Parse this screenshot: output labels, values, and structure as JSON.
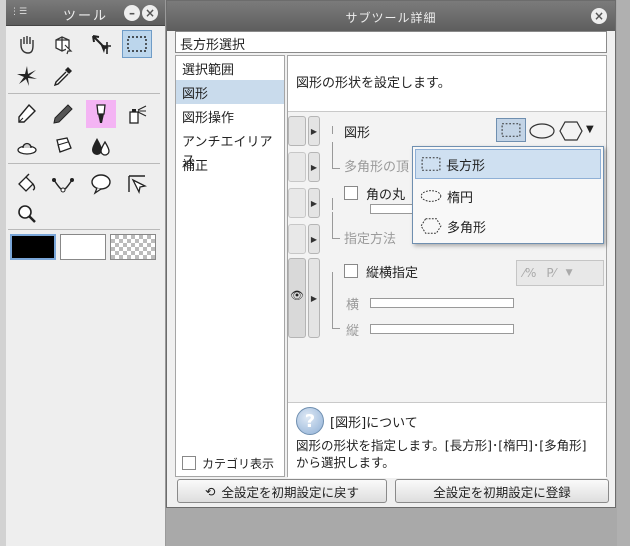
{
  "tool_panel": {
    "title": "ツール",
    "tools": [
      {
        "name": "hand-icon"
      },
      {
        "name": "object-icon"
      },
      {
        "name": "move-icon"
      },
      {
        "name": "selection-icon"
      },
      {
        "name": "sparkle-icon"
      },
      {
        "name": "eyedropper-icon"
      },
      {
        "name": "pen-icon"
      },
      {
        "name": "pencil-icon"
      },
      {
        "name": "brush-icon"
      },
      {
        "name": "airbrush-icon"
      },
      {
        "name": "blend-icon"
      },
      {
        "name": "eraser-icon"
      },
      {
        "name": "fill-icon"
      },
      {
        "name": "bucket-icon"
      },
      {
        "name": "ruler-icon"
      },
      {
        "name": "balloon-icon"
      },
      {
        "name": "line-icon"
      },
      {
        "name": "zoom-icon"
      }
    ],
    "colors": {
      "main": "#000000",
      "sub": "#ffffff"
    }
  },
  "sub_tool_detail": {
    "title": "サブツール詳細",
    "tool_name": "長方形選択",
    "categories": [
      "選択範囲",
      "図形",
      "図形操作",
      "アンチエイリアス",
      "補正"
    ],
    "selected_category": "図形",
    "category_toggle_label": "カテゴリ表示",
    "description": "図形の形状を設定します。",
    "props": {
      "shape_label": "図形",
      "polygon_label": "多角形の頂",
      "corner_label": "角の丸",
      "method_label": "指定方法",
      "aspect_label": "縦横指定",
      "width_label": "横",
      "height_label": "縦"
    },
    "dropdown": [
      "長方形",
      "楕円",
      "多角形"
    ],
    "about_title": "[図形]について",
    "about_body": "図形の形状を指定します。[長方形]･[楕円]･[多角形]から選択します。",
    "reset_button": "全設定を初期設定に戻す",
    "register_button": "全設定を初期設定に登録"
  }
}
